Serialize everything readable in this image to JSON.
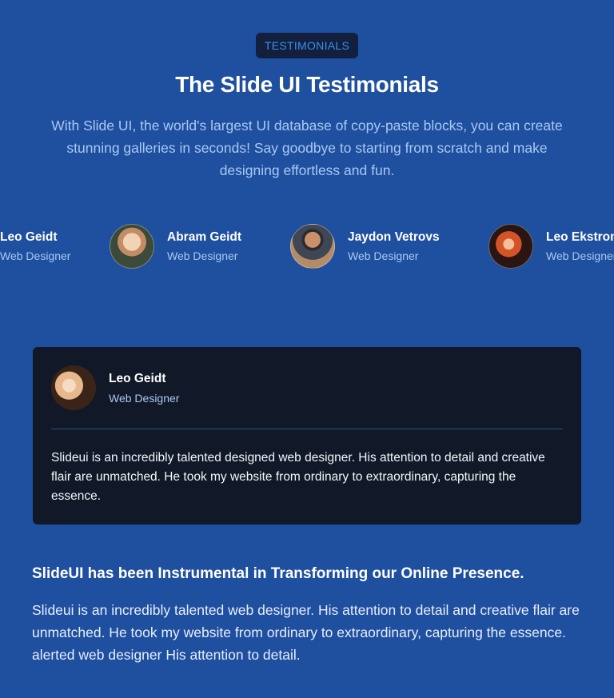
{
  "header": {
    "badge": "TESTIMONIALS",
    "title": "The Slide UI Testimonials",
    "intro": "With Slide UI, the world's largest UI database of copy-paste blocks, you can create stunning galleries in seconds! Say goodbye to starting from scratch and make designing effortless and fun."
  },
  "carousel": [
    {
      "name": "Leo Geidt",
      "role": "Web Designer"
    },
    {
      "name": "Abram Geidt",
      "role": "Web Designer"
    },
    {
      "name": "Jaydon Vetrovs",
      "role": "Web Designer"
    },
    {
      "name": "Leo Ekstrom",
      "role": "Web Designer"
    }
  ],
  "active_testimonial": {
    "name": "Leo Geidt",
    "role": "Web Designer",
    "quote": "Slideui is an incredibly talented designed web designer. His attention to detail and creative flair are unmatched. He took my website from ordinary to extraordinary, capturing the essence."
  },
  "feature": {
    "title": "SlideUI has been Instrumental in Transforming our Online Presence.",
    "text": "Slideui is an incredibly talented web designer. His attention to detail and creative flair are unmatched. He took my website from ordinary to extraordinary, capturing the essence. alerted web designer His attention to detail."
  },
  "colors": {
    "background": "#1f4f9f",
    "badge_bg": "#12203d",
    "badge_text": "#3b8ff0",
    "card_bg": "#111827",
    "muted_text": "#a9c9f2"
  }
}
